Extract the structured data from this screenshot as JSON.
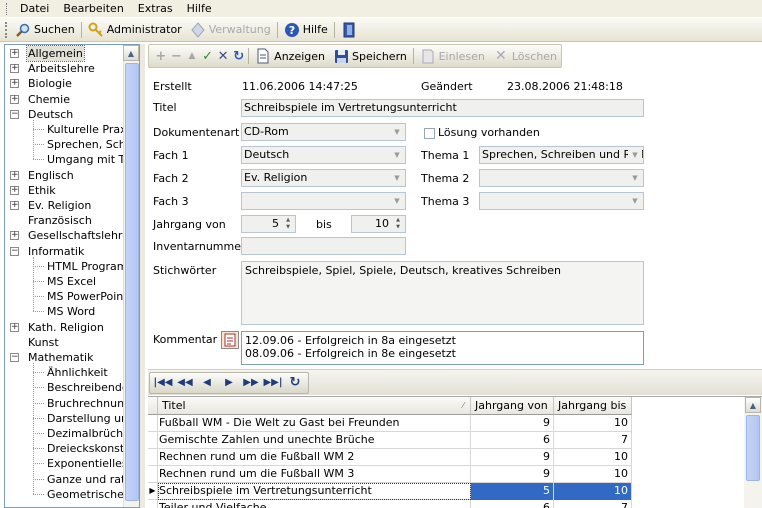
{
  "menu": [
    "Datei",
    "Bearbeiten",
    "Extras",
    "Hilfe"
  ],
  "toolbar": {
    "search_label": "Suchen",
    "admin_label": "Administrator",
    "manage_label": "Verwaltung",
    "help_label": "Hilfe"
  },
  "tree": [
    {
      "label": "Allgemein",
      "level": 0,
      "exp": "+",
      "sel": true
    },
    {
      "label": "Arbeitslehre",
      "level": 0,
      "exp": "+"
    },
    {
      "label": "Biologie",
      "level": 0,
      "exp": "+"
    },
    {
      "label": "Chemie",
      "level": 0,
      "exp": "+"
    },
    {
      "label": "Deutsch",
      "level": 0,
      "exp": "−"
    },
    {
      "label": "Kulturelle Praxis",
      "level": 1
    },
    {
      "label": "Sprechen, Schreiben und Reflexion",
      "level": 1
    },
    {
      "label": "Umgang mit Texten",
      "level": 1
    },
    {
      "label": "Englisch",
      "level": 0,
      "exp": "+"
    },
    {
      "label": "Ethik",
      "level": 0,
      "exp": "+"
    },
    {
      "label": "Ev. Religion",
      "level": 0,
      "exp": "+"
    },
    {
      "label": "Französisch",
      "level": 0
    },
    {
      "label": "Gesellschaftslehre",
      "level": 0,
      "exp": "+"
    },
    {
      "label": "Informatik",
      "level": 0,
      "exp": "−"
    },
    {
      "label": "HTML Programmierung",
      "level": 1
    },
    {
      "label": "MS Excel",
      "level": 1
    },
    {
      "label": "MS PowerPoint",
      "level": 1
    },
    {
      "label": "MS Word",
      "level": 1
    },
    {
      "label": "Kath. Religion",
      "level": 0,
      "exp": "+"
    },
    {
      "label": "Kunst",
      "level": 0
    },
    {
      "label": "Mathematik",
      "level": 0,
      "exp": "−"
    },
    {
      "label": "Ähnlichkeit",
      "level": 1
    },
    {
      "label": "Beschreibende Statistik",
      "level": 1
    },
    {
      "label": "Bruchrechnung",
      "level": 1
    },
    {
      "label": "Darstellung und Berechnung",
      "level": 1
    },
    {
      "label": "Dezimalbrüche",
      "level": 1
    },
    {
      "label": "Dreieckskonstruktion",
      "level": 1
    },
    {
      "label": "Exponentielles Wachstum",
      "level": 1
    },
    {
      "label": "Ganze und rationale Zahlen",
      "level": 1
    },
    {
      "label": "Geometrische Grundbegriffe",
      "level": 1
    }
  ],
  "detail_toolbar": {
    "show_label": "Anzeigen",
    "save_label": "Speichern",
    "import_label": "Einlesen",
    "delete_label": "Löschen"
  },
  "form": {
    "created_label": "Erstellt",
    "created_value": "11.06.2006 14:47:25",
    "changed_label": "Geändert",
    "changed_value": "23.08.2006 21:48:18",
    "title_label": "Titel",
    "title_value": "Schreibspiele im Vertretungsunterricht",
    "doctype_label": "Dokumentenart",
    "doctype_value": "CD-Rom",
    "solution_label": "Lösung vorhanden",
    "fach1_label": "Fach 1",
    "fach1_value": "Deutsch",
    "thema1_label": "Thema 1",
    "thema1_value": "Sprechen, Schreiben und Reflexion",
    "fach2_label": "Fach 2",
    "fach2_value": "Ev. Religion",
    "thema2_label": "Thema 2",
    "thema2_value": "",
    "fach3_label": "Fach 3",
    "fach3_value": "",
    "thema3_label": "Thema 3",
    "thema3_value": "",
    "jahrgang_label": "Jahrgang von",
    "jahrgang_from": "5",
    "bis_label": "bis",
    "jahrgang_to": "10",
    "inventory_label": "Inventarnummer",
    "inventory_value": "",
    "keywords_label": "Stichwörter",
    "keywords_value": "Schreibspiele, Spiel, Spiele, Deutsch, kreatives Schreiben",
    "comment_label": "Kommentar",
    "comment_line1": "12.09.06 - Erfolgreich in 8a eingesetzt",
    "comment_line2": "08.09.06 - Erfolgreich in 8e eingesetzt"
  },
  "grid": {
    "headers": [
      "Titel",
      "Jahrgang von",
      "Jahrgang bis"
    ],
    "rows": [
      {
        "title": "Fußball WM - Die Welt zu Gast bei Freunden",
        "from": "9",
        "to": "10"
      },
      {
        "title": "Gemischte Zahlen und unechte Brüche",
        "from": "6",
        "to": "7"
      },
      {
        "title": "Rechnen rund um die Fußball WM 2",
        "from": "9",
        "to": "10"
      },
      {
        "title": "Rechnen rund um die Fußball WM 3",
        "from": "9",
        "to": "10"
      },
      {
        "title": "Schreibspiele im Vertretungsunterricht",
        "from": "5",
        "to": "10",
        "selected": true
      },
      {
        "title": "Teiler und Vielfache",
        "from": "6",
        "to": "7"
      }
    ]
  }
}
